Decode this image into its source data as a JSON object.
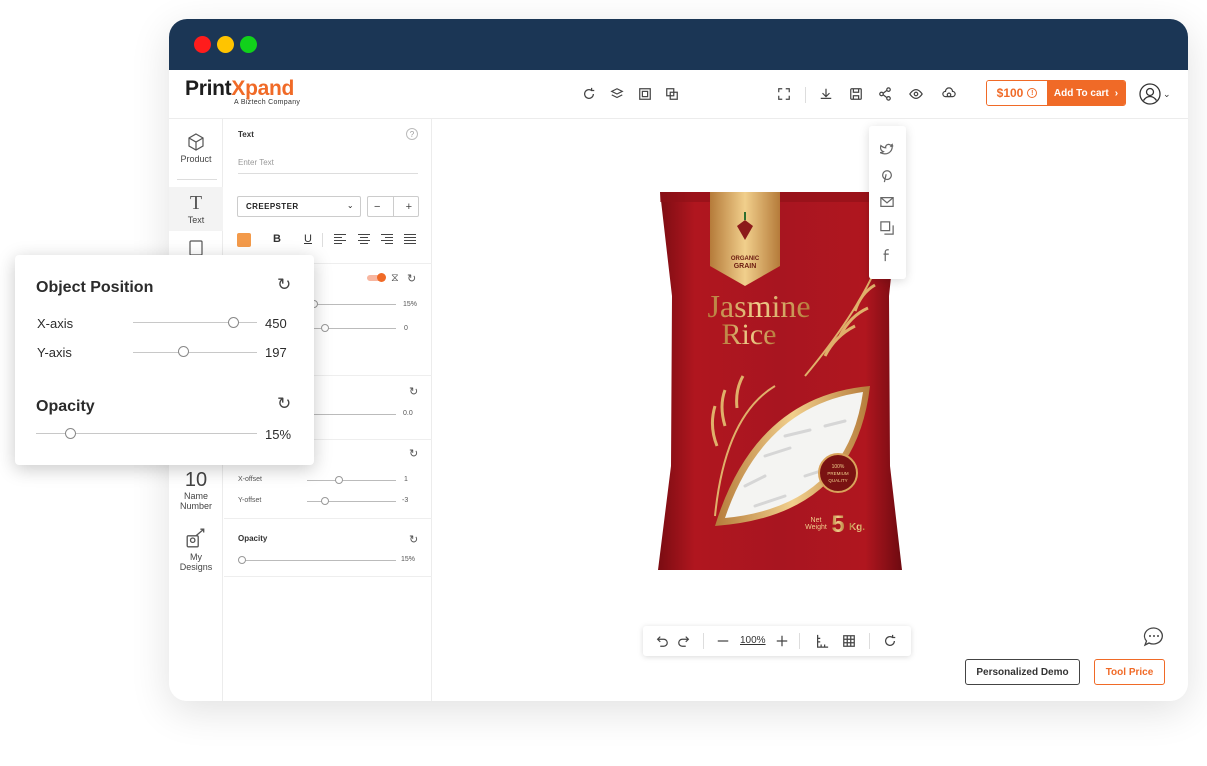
{
  "brand": {
    "name_start": "Print",
    "name_x": "X",
    "name_end": "pand",
    "tagline": "A Biztech Company"
  },
  "header": {
    "price": "$100",
    "price_info_icon": "info-icon",
    "add_to_cart": "Add To cart"
  },
  "sidebar": {
    "items": [
      {
        "label": "Product",
        "icon": "cube-icon"
      },
      {
        "label": "Text",
        "icon": "text-icon"
      },
      {
        "label": "Name\nNumber",
        "icon_text": "10"
      },
      {
        "label": "My\nDesigns",
        "icon": "designs-icon"
      }
    ]
  },
  "text_panel": {
    "section_text": "Text",
    "text_placeholder": "Enter Text",
    "font": "CREEPSTER",
    "stepper_minus": "−",
    "stepper_plus": "+",
    "bold": "B",
    "underline": "U",
    "curve_percent": "15%",
    "rotation": "0",
    "spacing": "0.0",
    "x_offset_label": "X-offset",
    "x_offset": "1",
    "y_offset_label": "Y-offset",
    "y_offset": "-3",
    "opacity_label": "Opacity",
    "opacity": "15%"
  },
  "zoom": {
    "value": "100%"
  },
  "footer_buttons": {
    "demo": "Personalized Demo",
    "tool_price": "Tool Price"
  },
  "product_bag": {
    "badge_top": "ORGANIC",
    "badge_bottom": "GRAIN",
    "title_line1": "Jasmine",
    "title_line2": "Rice",
    "seal_top": "100%",
    "seal_mid": "PREMIUM",
    "seal_bottom": "QUALITY",
    "net_weight_label1": "Net",
    "net_weight_label2": "Weight",
    "net_weight_value": "5",
    "net_weight_unit": "Kg."
  },
  "object_position_popup": {
    "title": "Object Position",
    "x_label": "X-axis",
    "x_value": "450",
    "y_label": "Y-axis",
    "y_value": "197",
    "opacity_title": "Opacity",
    "opacity_value": "15%"
  },
  "colors": {
    "accent": "#f06a27",
    "titlebar": "#1b3655",
    "bag_red": "#a8141d",
    "gold": "#d9a35b"
  }
}
